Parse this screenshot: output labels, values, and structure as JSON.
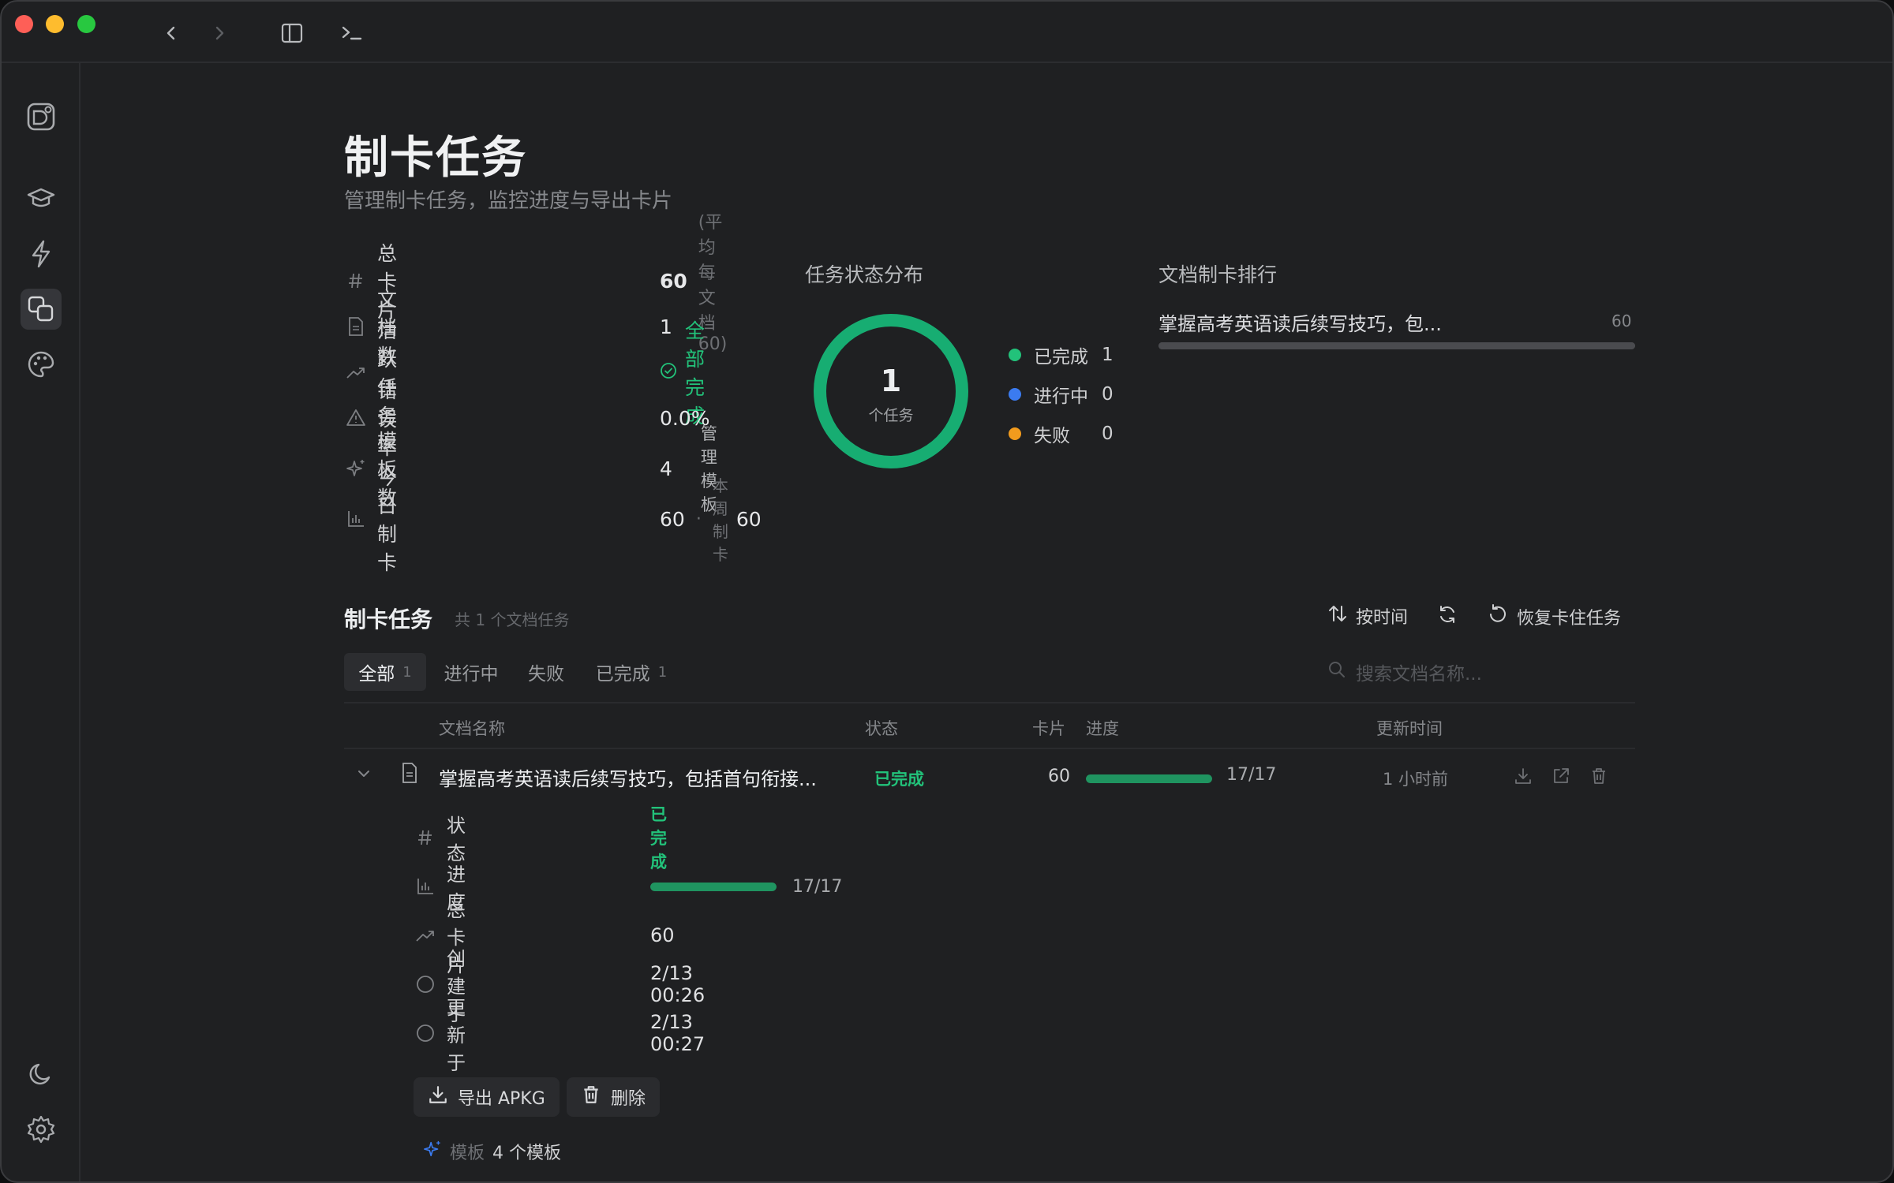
{
  "colors": {
    "background": "#1f2022",
    "accent_green": "#22c27a",
    "status_blue": "#3b7bf0",
    "status_orange": "#f29b1d",
    "traffic_red": "#fe5f57",
    "traffic_yellow": "#febc2e",
    "traffic_green": "#28c840"
  },
  "titlebar": {
    "icons": [
      "back-arrow-icon",
      "forward-arrow-icon",
      "sidebar-toggle-icon",
      "terminal-icon"
    ]
  },
  "sidebar": {
    "top_items": [
      "app-logo-icon",
      "graduation-cap-icon",
      "lightning-icon",
      "copy-cards-icon",
      "palette-icon"
    ],
    "active_item": "copy-cards-icon",
    "bottom_items": [
      "moon-icon",
      "gear-icon"
    ]
  },
  "page": {
    "title": "制卡任务",
    "subtitle": "管理制卡任务，监控进度与导出卡片"
  },
  "stats": {
    "total_cards": {
      "label": "总卡片",
      "value": "60",
      "note": "(平均每文档 60)"
    },
    "docs": {
      "label": "文档数",
      "value": "1"
    },
    "active_tasks": {
      "label": "活跃任务",
      "value": "全部完成"
    },
    "error_rate": {
      "label": "错误率",
      "value": "0.0%"
    },
    "templates": {
      "label": "模板数",
      "value": "4",
      "link": "管理模板"
    },
    "today": {
      "label": "今日制卡",
      "value": "60",
      "sep": "·",
      "week_label": "本周制卡",
      "week_value": "60"
    }
  },
  "status_chart": {
    "title": "任务状态分布",
    "center_value": "1",
    "center_label": "个任务",
    "legend": [
      {
        "label": "已完成",
        "value": "1"
      },
      {
        "label": "进行中",
        "value": "0"
      },
      {
        "label": "失败",
        "value": "0"
      }
    ]
  },
  "ranking": {
    "title": "文档制卡排行",
    "items": [
      {
        "name": "掌握高考英语读后续写技巧，包...",
        "value": "60",
        "fraction": 1.0
      }
    ]
  },
  "tasks": {
    "title": "制卡任务",
    "count_text": "共 1 个文档任务",
    "sort_label": "按时间",
    "restore_label": "恢复卡住任务",
    "tabs": [
      {
        "label": "全部",
        "count": "1"
      },
      {
        "label": "进行中",
        "count": ""
      },
      {
        "label": "失败",
        "count": ""
      },
      {
        "label": "已完成",
        "count": "1"
      }
    ],
    "active_tab": "全部",
    "search_placeholder": "搜索文档名称...",
    "columns": {
      "name": "文档名称",
      "status": "状态",
      "cards": "卡片",
      "progress": "进度",
      "updated": "更新时间"
    },
    "rows": [
      {
        "name": "掌握高考英语读后续写技巧，包括首句衔接...",
        "status": "已完成",
        "cards": "60",
        "progress_text": "17/17",
        "progress_fraction": 1.0,
        "updated": "1 小时前",
        "expanded": true,
        "details": {
          "status_label": "状态",
          "status_value": "已完成",
          "progress_label": "进度",
          "progress_value": "17/17",
          "progress_fraction": 1.0,
          "cards_label": "总卡片",
          "cards_value": "60",
          "created_label": "创建于",
          "created_value": "2/13 00:26",
          "updated_label": "更新于",
          "updated_value": "2/13 00:27"
        },
        "actions": {
          "export": "导出 APKG",
          "delete": "删除"
        },
        "template": {
          "label": "模板",
          "value": "4 个模板"
        }
      }
    ]
  }
}
